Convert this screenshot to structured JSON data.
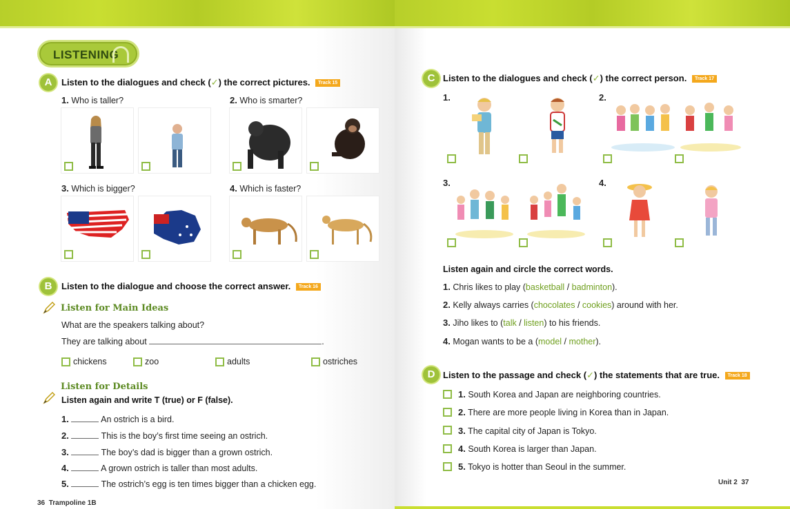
{
  "header_badge": "LISTENING",
  "section_a": {
    "letter": "A",
    "instruction_pre": "Listen to the dialogues and check (",
    "check_glyph": "✓",
    "instruction_post": ") the correct pictures.",
    "track": "Track 15",
    "questions": [
      {
        "num": "1.",
        "text": "Who is taller?"
      },
      {
        "num": "2.",
        "text": "Who is smarter?"
      },
      {
        "num": "3.",
        "text": "Which is bigger?"
      },
      {
        "num": "4.",
        "text": "Which is faster?"
      }
    ]
  },
  "section_b": {
    "letter": "B",
    "instruction": "Listen to the dialogue and choose the correct answer.",
    "track": "Track 16",
    "main_ideas": {
      "heading": "Listen for Main Ideas",
      "question": "What are the speakers talking about?",
      "stem": "They are talking about",
      "options": [
        "chickens",
        "zoo",
        "adults",
        "ostriches"
      ]
    },
    "details": {
      "heading": "Listen for Details",
      "instruction": "Listen again and write T (true) or F (false).",
      "items": [
        {
          "num": "1.",
          "text": "An ostrich is a bird."
        },
        {
          "num": "2.",
          "text": "This is the boy’s first time seeing an ostrich."
        },
        {
          "num": "3.",
          "text": "The boy’s dad is bigger than a grown ostrich."
        },
        {
          "num": "4.",
          "text": "A grown ostrich is taller than most adults."
        },
        {
          "num": "5.",
          "text": "The ostrich’s egg is ten times bigger than a chicken egg."
        }
      ]
    }
  },
  "footer_left": {
    "page": "36",
    "book": "Trampoline 1B"
  },
  "section_c": {
    "letter": "C",
    "instruction_pre": "Listen to the dialogues and check (",
    "check_glyph": "✓",
    "instruction_post": ") the correct person.",
    "track": "Track 17",
    "nums": [
      "1.",
      "2.",
      "3.",
      "4."
    ],
    "circle_heading": "Listen again and circle the correct words.",
    "circle_items": [
      {
        "num": "1.",
        "pre": "Chris likes to play (",
        "opt1": "basketball",
        "sep": " / ",
        "opt2": "badminton",
        "post": ")."
      },
      {
        "num": "2.",
        "pre": "Kelly always carries (",
        "opt1": "chocolates",
        "sep": " / ",
        "opt2": "cookies",
        "post": ") around with her."
      },
      {
        "num": "3.",
        "pre": "Jiho likes to (",
        "opt1": "talk",
        "sep": " / ",
        "opt2": "listen",
        "post": ") to his friends."
      },
      {
        "num": "4.",
        "pre": "Mogan wants to be a (",
        "opt1": "model",
        "sep": " / ",
        "opt2": "mother",
        "post": ")."
      }
    ]
  },
  "section_d": {
    "letter": "D",
    "instruction_pre": "Listen to the passage and check (",
    "check_glyph": "✓",
    "instruction_post": ") the statements that are true.",
    "track": "Track 18",
    "items": [
      {
        "num": "1.",
        "text": "South Korea and Japan are neighboring countries."
      },
      {
        "num": "2.",
        "text": "There are more people living in Korea than in Japan."
      },
      {
        "num": "3.",
        "text": "The capital city of Japan is Tokyo."
      },
      {
        "num": "4.",
        "text": "South Korea is larger than Japan."
      },
      {
        "num": "5.",
        "text": "Tokyo is hotter than Seoul in the summer."
      }
    ]
  },
  "footer_right": {
    "unit": "Unit 2",
    "page": "37"
  },
  "colors": {
    "accent": "#9fc23a",
    "band": "#c9de31",
    "track": "#f4a81c",
    "option_green": "#6f9f1e"
  }
}
